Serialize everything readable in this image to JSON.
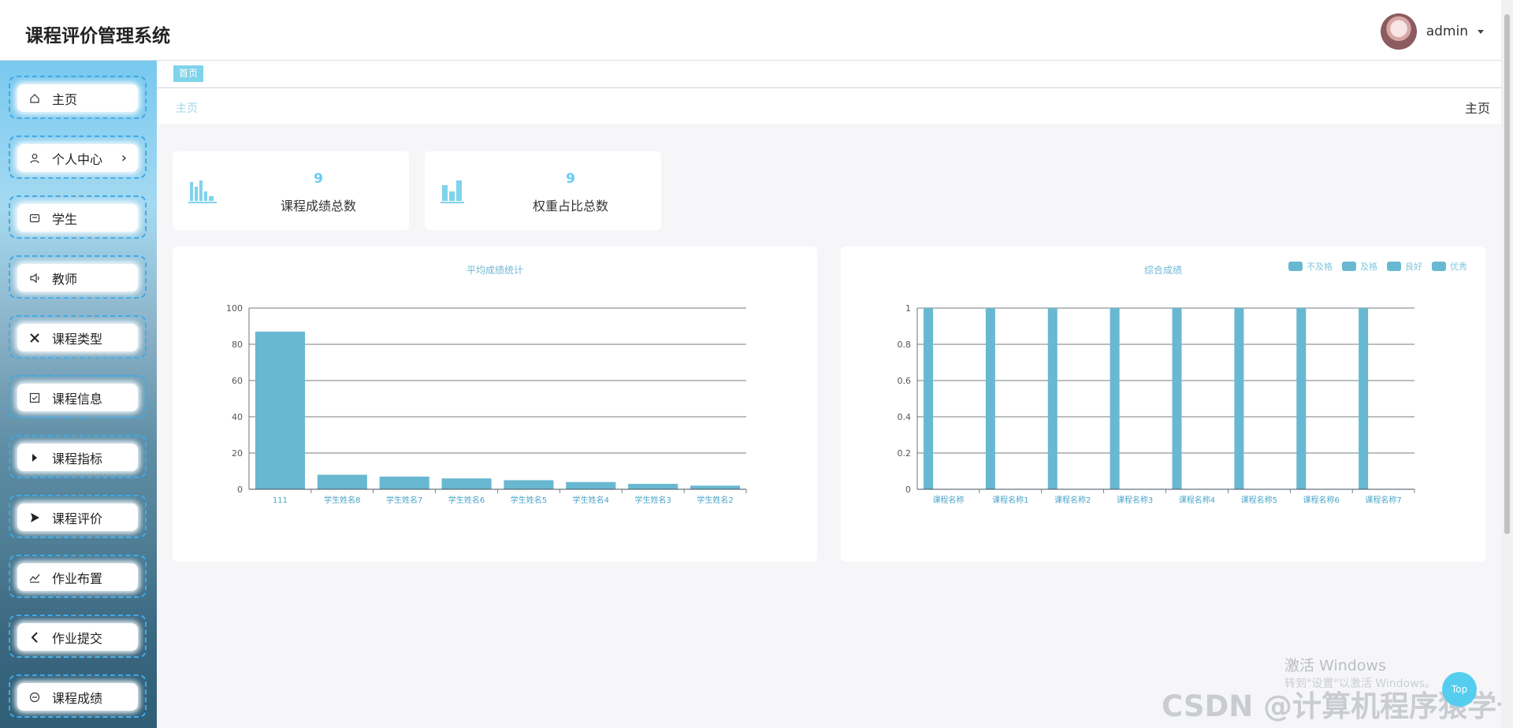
{
  "header": {
    "title": "课程评价管理系统",
    "user": "admin"
  },
  "sidebar": {
    "items": [
      {
        "label": "主页",
        "icon": "home-icon"
      },
      {
        "label": "个人中心",
        "icon": "user-icon",
        "has_arrow": true
      },
      {
        "label": "学生",
        "icon": "id-card-icon"
      },
      {
        "label": "教师",
        "icon": "speaker-icon"
      },
      {
        "label": "课程类型",
        "icon": "close-icon"
      },
      {
        "label": "课程信息",
        "icon": "checkbox-icon"
      },
      {
        "label": "课程指标",
        "icon": "caret-right-icon"
      },
      {
        "label": "课程评价",
        "icon": "play-icon"
      },
      {
        "label": "作业布置",
        "icon": "trend-icon"
      },
      {
        "label": "作业提交",
        "icon": "chevron-left-icon"
      },
      {
        "label": "课程成绩",
        "icon": "minus-circle-icon"
      }
    ]
  },
  "tabs": [
    {
      "label": "首页",
      "active": true
    }
  ],
  "breadcrumb": "主页",
  "page_title": "主页",
  "stats": [
    {
      "value": "9",
      "label": "课程成绩总数",
      "icon": "bar-chart-icon"
    },
    {
      "value": "9",
      "label": "权重占比总数",
      "icon": "bar-chart-icon"
    }
  ],
  "chart_data": [
    {
      "type": "bar",
      "title": "平均成绩统计",
      "categories": [
        "111",
        "学生姓名8",
        "学生姓名7",
        "学生姓名6",
        "学生姓名5",
        "学生姓名4",
        "学生姓名3",
        "学生姓名2"
      ],
      "values": [
        87,
        8,
        7,
        6,
        5,
        4,
        3,
        2
      ],
      "ylim": [
        0,
        100
      ],
      "yticks": [
        0,
        20,
        40,
        60,
        80,
        100
      ],
      "color": "#68b8d1",
      "grid": true
    },
    {
      "type": "bar",
      "title": "综合成绩",
      "categories": [
        "课程名称",
        "课程名称1",
        "课程名称2",
        "课程名称3",
        "课程名称4",
        "课程名称5",
        "课程名称6",
        "课程名称7"
      ],
      "series": [
        {
          "name": "不及格",
          "values": [
            1,
            1,
            1,
            1,
            1,
            1,
            1,
            1
          ]
        },
        {
          "name": "及格",
          "values": [
            0,
            0,
            0,
            0,
            0,
            0,
            0,
            0
          ]
        },
        {
          "name": "良好",
          "values": [
            0,
            0,
            0,
            0,
            0,
            0,
            0,
            0
          ]
        },
        {
          "name": "优秀",
          "values": [
            0,
            0,
            0,
            0,
            0,
            0,
            0,
            0
          ]
        }
      ],
      "ylim": [
        0,
        1
      ],
      "yticks": [
        "0",
        "0.2",
        "0.4",
        "0.6",
        "0.8",
        "1"
      ],
      "legend_position": "top-right",
      "color": "#68b8d1",
      "grid": true
    }
  ],
  "watermark": {
    "line1": "激活 Windows",
    "line2": "转到\"设置\"以激活 Windows。",
    "csdn": "CSDN @计算机程序猿学长"
  },
  "top_button": "Top",
  "colors": {
    "accent": "#66ccf0",
    "bar": "#68b8d1",
    "tab": "#7fd3ea"
  }
}
